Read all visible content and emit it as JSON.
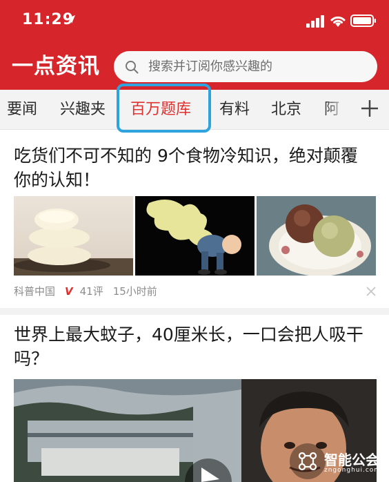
{
  "status_bar": {
    "time": "11:29"
  },
  "header": {
    "logo": "一点资讯",
    "search_placeholder": "搜索并订阅你感兴趣的"
  },
  "tabs": [
    {
      "label": "要闻"
    },
    {
      "label": "兴趣夹"
    },
    {
      "label": "百万题库",
      "active": true
    },
    {
      "label": "有料"
    },
    {
      "label": "北京"
    },
    {
      "label": "阿"
    }
  ],
  "articles": [
    {
      "title": "吃货们不可不知的 9个食物冷知识，绝对颠覆你的认知！",
      "source": "科普中国",
      "verified_mark": "V",
      "comments": "41评",
      "time": "15小时前"
    },
    {
      "title": "世界上最大蚊子，40厘米长，一口会把人吸干吗？"
    }
  ],
  "watermark": {
    "name": "智能公会",
    "url": "zngonghui.com"
  },
  "colors": {
    "header_red": "#d7262b",
    "active_tab": "#e0302e",
    "highlight_box": "#2fa3dd"
  }
}
